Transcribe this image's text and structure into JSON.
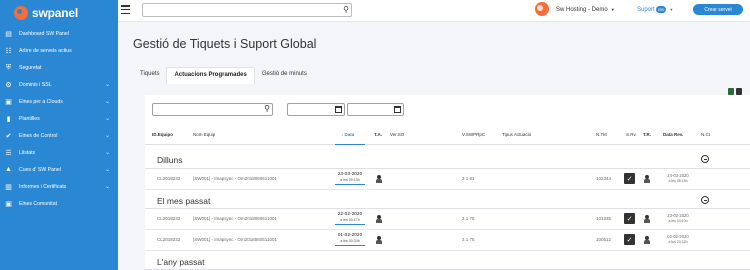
{
  "brand": {
    "name": "swpanel"
  },
  "sidebar": {
    "items": [
      {
        "label": "Dashboard SW Panel",
        "icon": "dashboard-icon",
        "chevron": false
      },
      {
        "label": "Arbre de serveis actius",
        "icon": "tree-icon",
        "chevron": false
      },
      {
        "label": "Seguretat",
        "icon": "shield-icon",
        "chevron": false
      },
      {
        "label": "Dominis i SSL",
        "icon": "gear-icon",
        "chevron": true
      },
      {
        "label": "Eines per a Clouds",
        "icon": "toolbox-icon",
        "chevron": true
      },
      {
        "label": "Plantilles",
        "icon": "file-icon",
        "chevron": true
      },
      {
        "label": "Eines de Control",
        "icon": "check-circle-icon",
        "chevron": true
      },
      {
        "label": "Llistats",
        "icon": "list-icon",
        "chevron": true
      },
      {
        "label": "Cues d' SW Panel",
        "icon": "graduation-icon",
        "chevron": true
      },
      {
        "label": "Informes i Certificats",
        "icon": "chart-icon",
        "chevron": true
      },
      {
        "label": "Eines Comunitat",
        "icon": "toolbox-icon",
        "chevron": false
      }
    ]
  },
  "topbar": {
    "search_placeholder": "",
    "company": "Sw Hosting - Demo",
    "suport_label": "Suport",
    "suport_badge": "250",
    "create_button": "Crear servei"
  },
  "page": {
    "title": "Gestió de Tiquets i Suport Global",
    "tabs": [
      "Tiquets",
      "Actuacions Programades",
      "Gestió de minuts"
    ],
    "active_tab": 1
  },
  "table": {
    "headers": {
      "id": "ID.Equipo",
      "nom": "Nom Equip",
      "data": "↓ Data",
      "ta": "T.A.",
      "verso": "Ver.SO",
      "vswp": "V.SWPRpC",
      "tipus": "Tipus Actuació",
      "ntkt": "N.Tkt",
      "sr": "S.Rv.",
      "tr": "T.R.",
      "datarev": "Data Rev.",
      "nci": "N.CI"
    },
    "groups": [
      {
        "name": "Dilluns"
      },
      {
        "name": "El mes passat"
      },
      {
        "name": "L'any passat"
      }
    ],
    "rows": [
      {
        "id": "CL2018232",
        "nom": "[SW001] - Imapsync - Om2018060511001",
        "date": "23-03-2020",
        "ago": "a les 09:15h",
        "vswp": "2.1.61",
        "ntkt": "102344",
        "rev_date": "24-03-2020",
        "rev_time": "a les 08:15h"
      },
      {
        "id": "CL2018232",
        "nom": "[SW001] - Imapsync - Om2018060511001",
        "date": "22-02-2020",
        "ago": "a les 00:17h",
        "vswp": "2.1.75",
        "ntkt": "101335",
        "rev_date": "23-02-2020",
        "rev_time": "a les 04:10h"
      },
      {
        "id": "CL2018232",
        "nom": "[SW001] - Imapsync - Om2018060511001",
        "date": "01-02-2020",
        "ago": "a les 00:34h",
        "vswp": "2.1.75",
        "ntkt": "100512",
        "rev_date": "02-02-2020",
        "rev_time": "a les 23:32h"
      }
    ]
  },
  "colors": {
    "accent": "#2a87d3",
    "brand_orange": "#f36f3a",
    "sidebar": "#2a87d3"
  }
}
